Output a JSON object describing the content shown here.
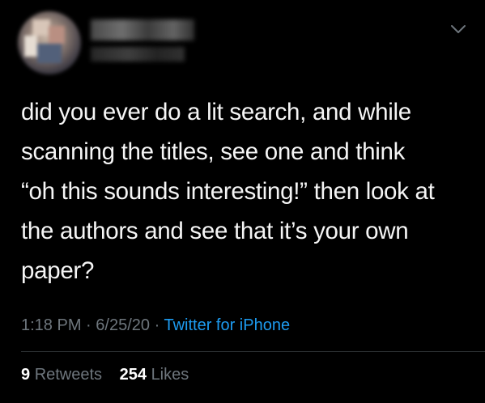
{
  "tweet": {
    "text_lines": [
      "did you ever do a lit search, and while",
      "scanning the titles, see one and think",
      "“oh this sounds interesting!” then look at",
      "the authors and see that it’s your own",
      "paper?"
    ],
    "time": "1:18 PM",
    "separator": "·",
    "date": "6/25/20",
    "source": "Twitter for iPhone",
    "retweets_count": "9",
    "retweets_label": "Retweets",
    "likes_count": "254",
    "likes_label": "Likes"
  },
  "icons": {
    "menu": "chevron-down-icon"
  },
  "colors": {
    "background": "#000000",
    "text": "#f5f5f5",
    "muted": "#6e767d",
    "link": "#1d9bf0",
    "divider": "#2f3336"
  }
}
